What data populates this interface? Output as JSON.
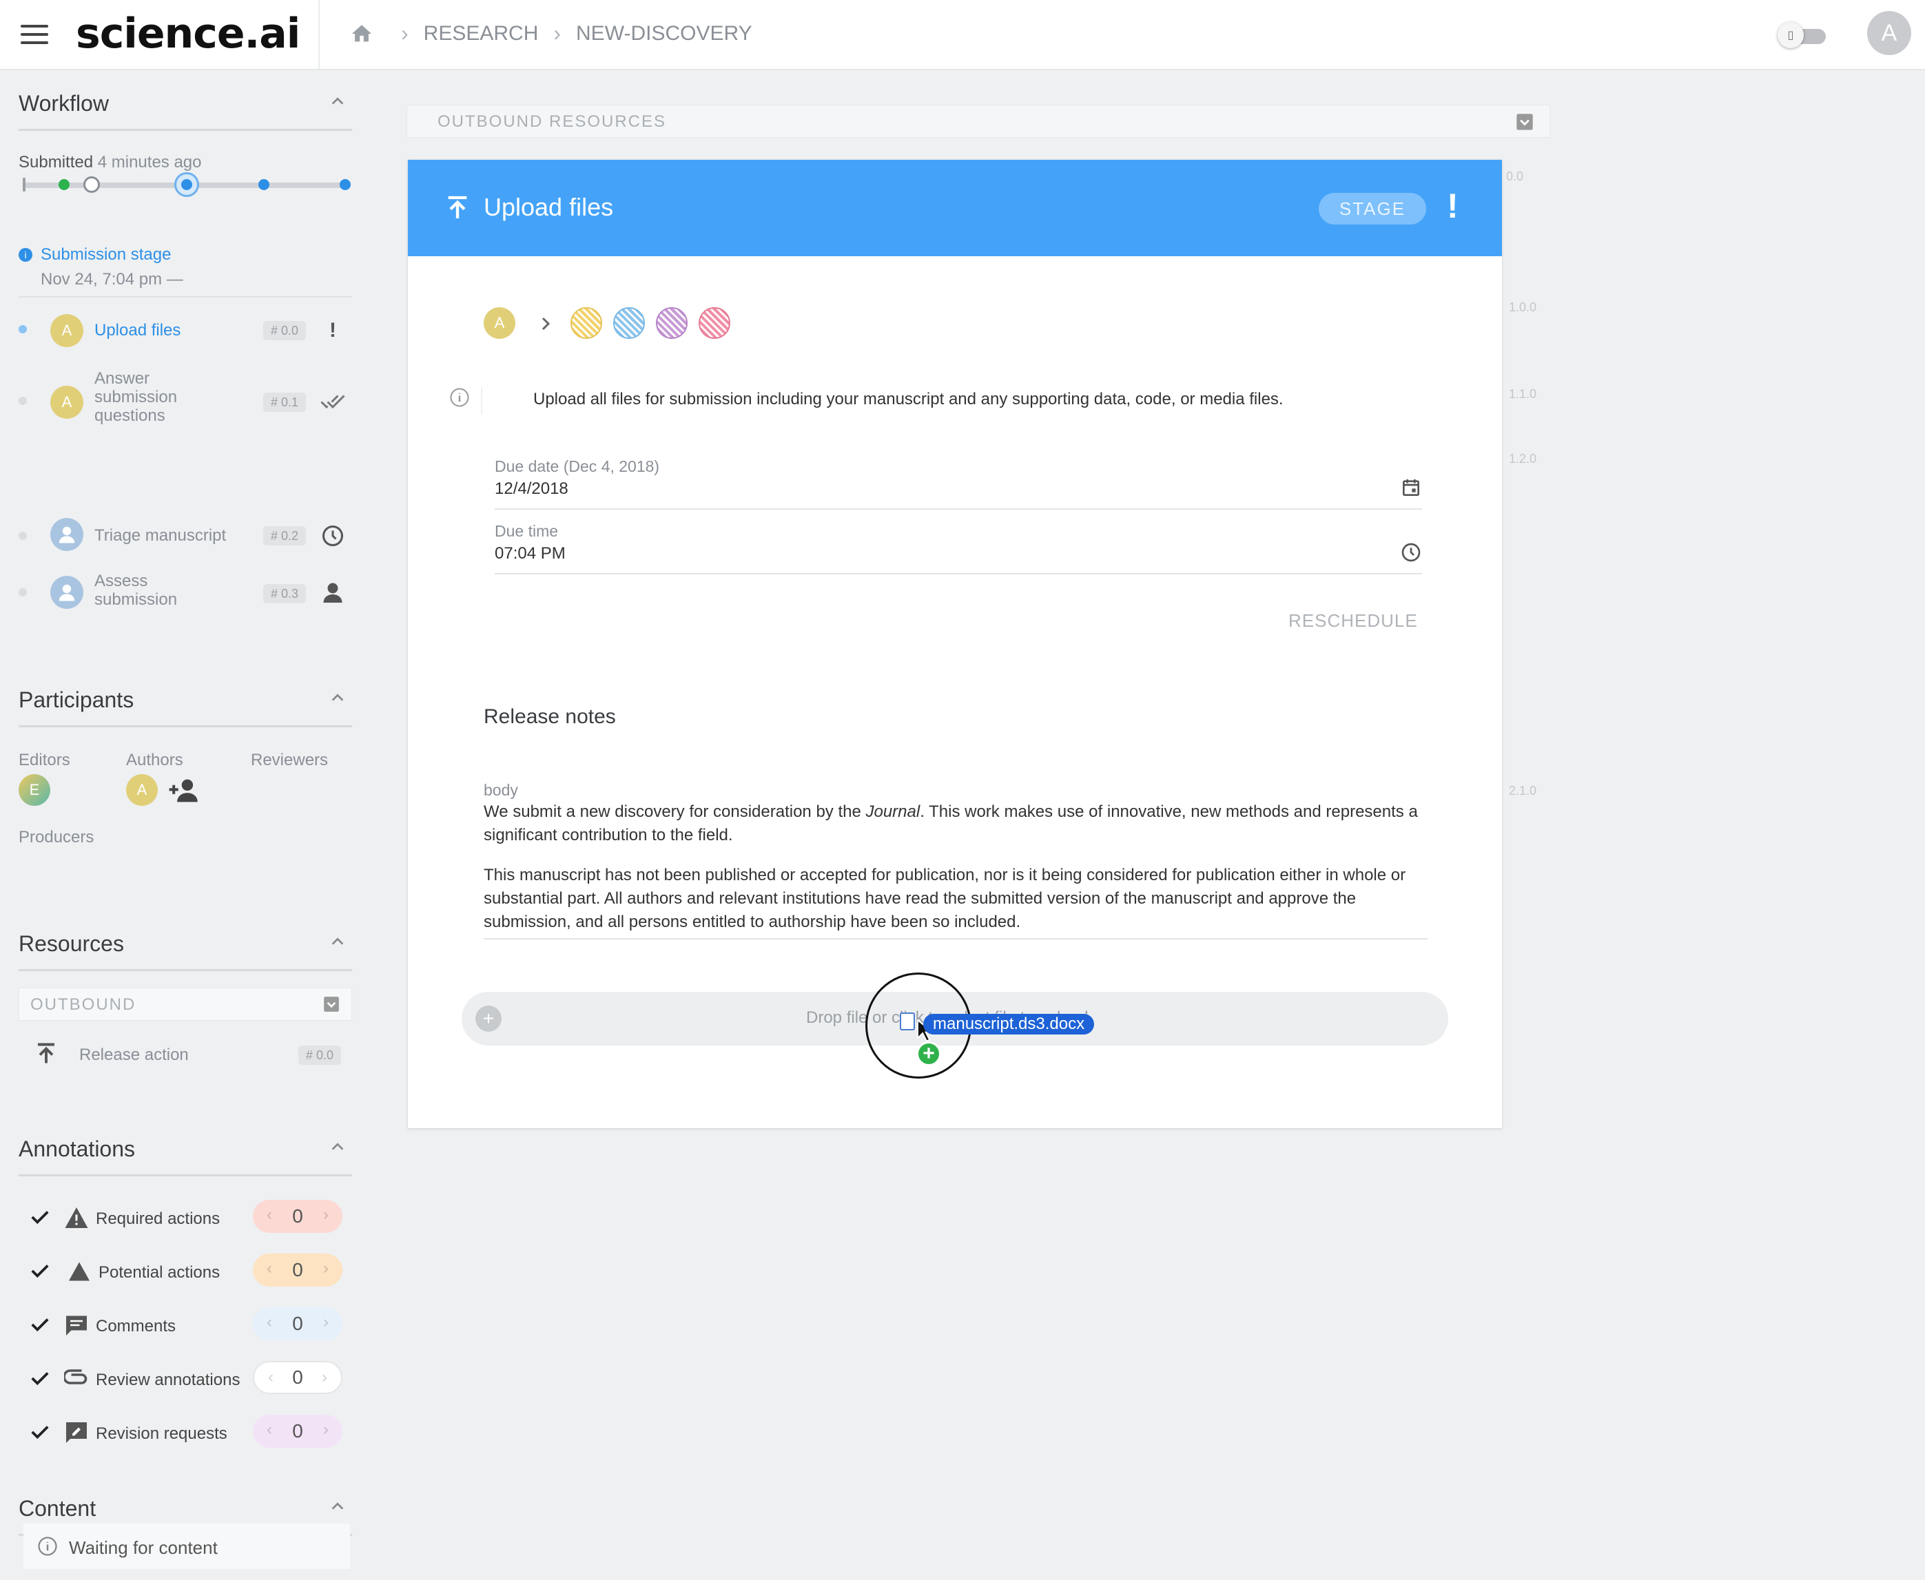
{
  "app": {
    "logo": "science.ai"
  },
  "breadcrumb": [
    "RESEARCH",
    "NEW-DISCOVERY"
  ],
  "user": {
    "avatar_initial": "A"
  },
  "workflow": {
    "title": "Workflow",
    "submitted_label": "Submitted",
    "submitted_ago": "4 minutes ago",
    "stage_name": "Submission stage",
    "stage_date": "Nov 24, 7:04 pm —",
    "items": [
      {
        "initial": "A",
        "label": "Upload files",
        "num": "# 0.0",
        "status": "!"
      },
      {
        "initial": "A",
        "label": "Answer submission questions",
        "num": "# 0.1",
        "status": "done-all"
      },
      {
        "initial": "",
        "label": "Triage manuscript",
        "num": "# 0.2",
        "status": "clock"
      },
      {
        "initial": "",
        "label": "Assess submission",
        "num": "# 0.3",
        "status": "person"
      }
    ]
  },
  "participants": {
    "title": "Participants",
    "columns": [
      "Editors",
      "Authors",
      "Reviewers"
    ],
    "producers_label": "Producers",
    "editor_initial": "E",
    "author_initial": "A"
  },
  "resources": {
    "title": "Resources",
    "outbound_label": "OUTBOUND",
    "item_label": "Release action",
    "item_num": "# 0.0"
  },
  "annotations": {
    "title": "Annotations",
    "items": [
      {
        "label": "Required actions",
        "count": "0",
        "color": "#fdd9d3"
      },
      {
        "label": "Potential actions",
        "count": "0",
        "color": "#fde3c2"
      },
      {
        "label": "Comments",
        "count": "0",
        "color": "#e6f0fb"
      },
      {
        "label": "Review annotations",
        "count": "0",
        "color": "#ffffff"
      },
      {
        "label": "Revision requests",
        "count": "0",
        "color": "#f3e3f7"
      }
    ]
  },
  "content": {
    "title": "Content",
    "waiting": "Waiting for content"
  },
  "main": {
    "outbound_resources": "OUTBOUND RESOURCES",
    "card_title": "Upload files",
    "stage_button": "STAGE",
    "alert": "!",
    "flow_initial": "A",
    "instruction": "Upload all files for submission including your manuscript and any supporting data, code, or media files.",
    "due_date_label": "Due date (Dec 4, 2018)",
    "due_date_value": "12/4/2018",
    "due_time_label": "Due time",
    "due_time_value": "07:04 PM",
    "reschedule": "RESCHEDULE",
    "release_notes_title": "Release notes",
    "body_label": "body",
    "body_p1_before": "We submit a new discovery for consideration by the ",
    "body_p1_em": "Journal",
    "body_p1_after": ". This work makes use of innovative, new methods and represents a significant contribution to the field.",
    "body_p2": "This manuscript has not been published or accepted for publication, nor is it being considered for publication either in whole or substantial part. All authors and relevant institutions have read the submitted version of the manuscript and approve the submission, and all persons entitled to authorship have been so included.",
    "drop_text": "Drop file or click to select file to upload",
    "step_numbers": [
      "0.0",
      "1.0.0",
      "1.1.0",
      "1.2.0",
      "2.1.0"
    ]
  },
  "drag": {
    "filename": "manuscript.ds3.docx"
  },
  "colors": {
    "accent": "#44a3f8",
    "link": "#2d8fe6",
    "green_dot": "#2bb24c",
    "drag_chip": "#1d62d6"
  }
}
